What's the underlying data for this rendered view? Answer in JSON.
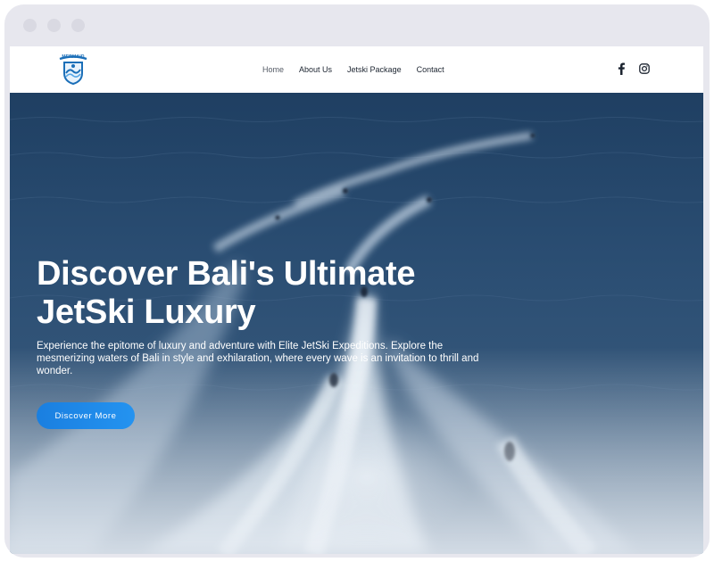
{
  "browser": {
    "window_dots": [
      "close",
      "minimize",
      "maximize"
    ]
  },
  "header": {
    "logo": {
      "text": "MERMAID",
      "icon": "wave-shield-logo"
    },
    "nav": [
      {
        "label": "Home",
        "active": true
      },
      {
        "label": "About Us",
        "active": false
      },
      {
        "label": "Jetski Package",
        "active": false
      },
      {
        "label": "Contact",
        "active": false
      }
    ],
    "socials": [
      {
        "name": "facebook-icon"
      },
      {
        "name": "instagram-icon"
      }
    ]
  },
  "hero": {
    "title_line1": "Discover Bali's Ultimate",
    "title_line2": "JetSki Luxury",
    "description": "Experience the epitome of luxury and adventure with Elite JetSki Expeditions. Explore the mesmerizing waters of Bali in style and exhilaration, where every wave is an invitation to thrill and wonder.",
    "cta_label": "Discover More"
  },
  "colors": {
    "accent": "#1f8be8",
    "ocean_dark": "#274a6d",
    "ocean_light": "#8ba8c4",
    "text_dark": "#1c2430"
  }
}
